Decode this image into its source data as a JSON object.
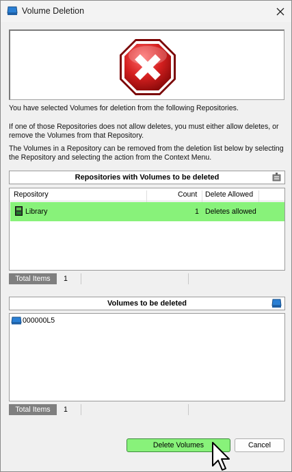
{
  "window": {
    "title": "Volume Deletion"
  },
  "messages": {
    "line1": "You have selected Volumes for deletion from the following Repositories.",
    "line2": "If one of those Repositories does not allow deletes, you must either allow deletes, or remove the Volumes from that Repository.",
    "line3": "The Volumes in a Repository can be removed from the deletion list below by selecting the Repository and selecting the action from the Context Menu."
  },
  "repositories_panel": {
    "header": "Repositories with Volumes to be deleted",
    "columns": [
      "Repository",
      "Count",
      "Delete Allowed"
    ],
    "rows": [
      {
        "repository": "Library",
        "count": "1",
        "delete_allowed": "Deletes allowed"
      }
    ],
    "total_label": "Total Items",
    "total_value": "1"
  },
  "volumes_panel": {
    "header": "Volumes to be deleted",
    "items": [
      "000000L5"
    ],
    "total_label": "Total Items",
    "total_value": "1"
  },
  "buttons": {
    "delete": "Delete Volumes",
    "cancel": "Cancel"
  },
  "colors": {
    "highlight": "#88f27a",
    "stop_red": "#d41f1f",
    "volume_blue": "#2a7fd4"
  },
  "icons": {
    "app": "volume-icon",
    "close": "close-icon",
    "banner": "stop-error-icon",
    "repo_header": "robot-icon",
    "volumes_header": "volume-icon",
    "library": "library-icon"
  }
}
